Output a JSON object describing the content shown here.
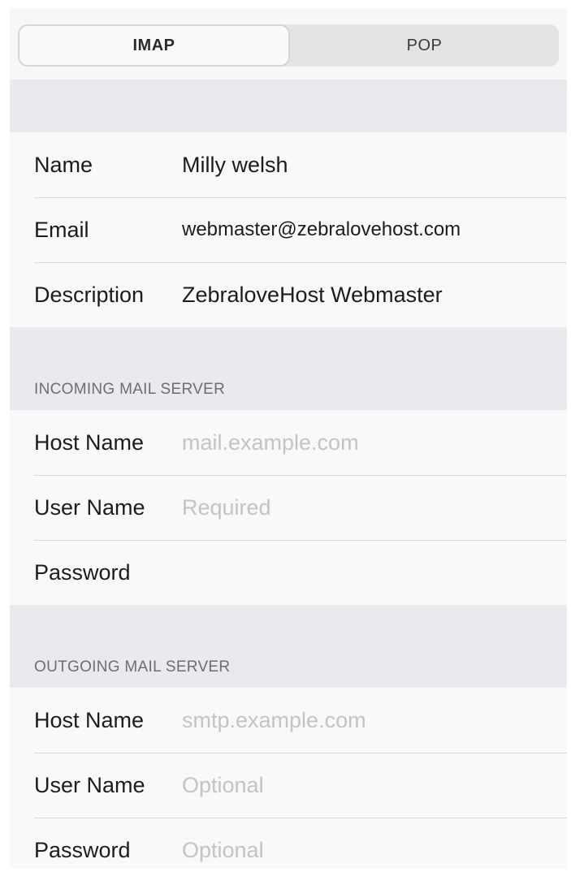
{
  "segments": {
    "imap": "IMAP",
    "pop": "POP",
    "selected": "IMAP"
  },
  "account": {
    "name_label": "Name",
    "name_value": "Milly welsh",
    "email_label": "Email",
    "email_value": "webmaster@zebralovehost.com",
    "description_label": "Description",
    "description_value": "ZebraloveHost Webmaster"
  },
  "incoming": {
    "header": "INCOMING MAIL SERVER",
    "host_label": "Host Name",
    "host_placeholder": "mail.example.com",
    "user_label": "User Name",
    "user_placeholder": "Required",
    "password_label": "Password",
    "password_placeholder": ""
  },
  "outgoing": {
    "header": "OUTGOING MAIL SERVER",
    "host_label": "Host Name",
    "host_placeholder": "smtp.example.com",
    "user_label": "User Name",
    "user_placeholder": "Optional",
    "password_label": "Password",
    "password_placeholder": "Optional"
  }
}
